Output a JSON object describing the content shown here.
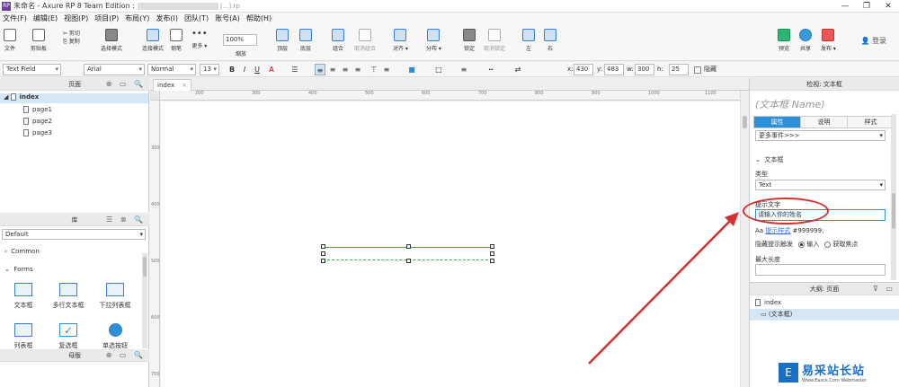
{
  "window": {
    "title": "未命名 - Axure RP 8 Team Edition :",
    "title_suffix": "[...].rp"
  },
  "menu": [
    "文件(F)",
    "编辑(E)",
    "视图(P)",
    "项目(P)",
    "布局(Y)",
    "发布(I)",
    "团队(T)",
    "账号(A)",
    "帮助(H)"
  ],
  "toolbar": {
    "file": "文件",
    "clipboard": "剪贴板",
    "cut": "剪切",
    "copy": "复制",
    "select_mode": "选择模式",
    "connect_mode": "连接模式",
    "pen": "钢笔",
    "more": "更多 ▾",
    "zoom_value": "100%",
    "zoom_label": "缩放",
    "top": "顶层",
    "bottom": "底层",
    "group": "组合",
    "ungroup": "取消组合",
    "align": "对齐 ▾",
    "distribute": "分布 ▾",
    "lock": "锁定",
    "unlock": "取消锁定",
    "left": "左",
    "right": "右",
    "preview": "预览",
    "share": "共享",
    "publish": "发布 ▾",
    "login": "登录"
  },
  "format": {
    "widget_type": "Text Field",
    "font": "Arial",
    "style": "Normal",
    "size": "13",
    "x_label": "x:",
    "x_value": "430",
    "y_label": "y:",
    "y_value": "483",
    "w_label": "w:",
    "w_value": "300",
    "h_label": "h:",
    "h_value": "25",
    "hidden_label": "隐藏"
  },
  "pages_panel": {
    "title": "页面",
    "items": [
      "index",
      "page1",
      "page2",
      "page3"
    ]
  },
  "library_panel": {
    "title": "库",
    "selected": "Default",
    "sections": [
      "Common",
      "Forms"
    ],
    "widgets": [
      "文本框",
      "多行文本框",
      "下拉列表框",
      "列表框",
      "复选框",
      "单选按钮"
    ]
  },
  "master_panel": {
    "title": "母版"
  },
  "canvas": {
    "tab": "index",
    "ruler_top": [
      "200",
      "300",
      "400",
      "500",
      "600",
      "700",
      "800",
      "900",
      "1000",
      "1100"
    ],
    "ruler_left": [
      "300",
      "400",
      "500",
      "600",
      "700"
    ]
  },
  "inspector": {
    "header": "检视: 文本框",
    "name_placeholder": "(文本框 Name)",
    "tabs": [
      "属性",
      "说明",
      "样式"
    ],
    "more_events": "更多事件>>>",
    "section": "文本框",
    "type_label": "类型",
    "type_value": "Text",
    "hint_label": "提示文字",
    "hint_value": "请输入你的姓名",
    "hint_style_link": "提示样式",
    "hint_color": "#999999;",
    "hide_hint_label": "隐藏提示触发",
    "opt_input": "输入",
    "opt_focus": "获取焦点",
    "max_len_label": "最大长度"
  },
  "outline": {
    "title": "大纲: 页面",
    "items": [
      "index",
      "(文本框)"
    ]
  },
  "watermark": {
    "title": "易采站长站",
    "sub": "Www.Easck.Com Webmaster"
  },
  "colors": {
    "accent": "#2d8fd6",
    "highlight": "#d62f2f",
    "selection_green": "#3cb043"
  }
}
